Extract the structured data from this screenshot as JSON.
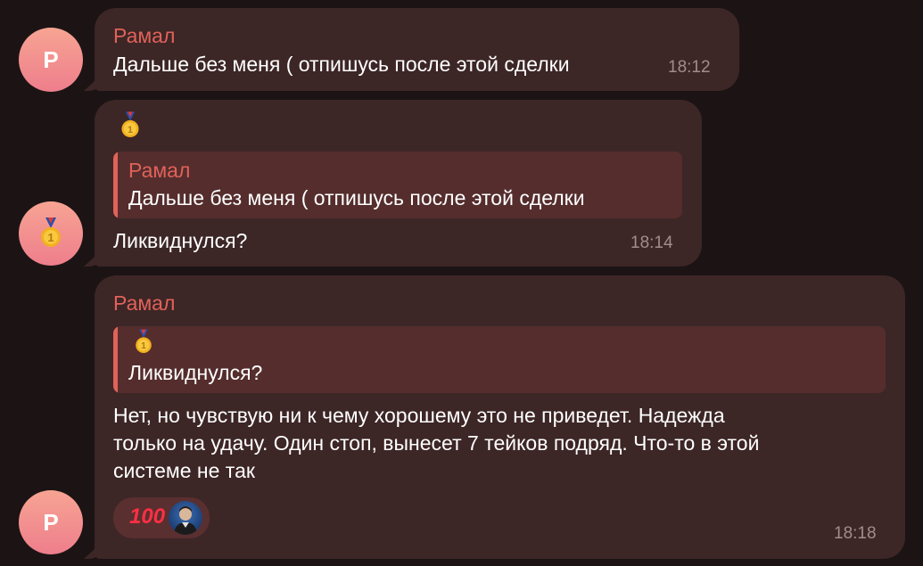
{
  "messages": [
    {
      "avatar_letter": "Р",
      "sender": "Рамал",
      "text": "Дальше без меня ( отпишусь после этой сделки",
      "time": "18:12"
    },
    {
      "avatar_icon": "medal-icon",
      "text": "Ликвиднулся?",
      "time": "18:14",
      "reply": {
        "sender": "Рамал",
        "text": "Дальше без меня ( отпишусь после этой сделки"
      }
    },
    {
      "avatar_letter": "Р",
      "sender": "Рамал",
      "reply": {
        "text": "Ликвиднулся?"
      },
      "text_lines": [
        "Нет, но чувствую ни к чему хорошему это не приведет. Надежда",
        "только на удачу. Один стоп, вынесет 7 тейков подряд. Что-то в этой",
        "системе не так"
      ],
      "reaction": {
        "emoji": "💯",
        "icon": "hundred-points-icon"
      },
      "time": "18:18"
    }
  ],
  "colors": {
    "background": "#1c1414",
    "bubble": "#3d2626",
    "quote": "#552d2d",
    "accent": "#e0625a",
    "time": "#a08d8d"
  }
}
